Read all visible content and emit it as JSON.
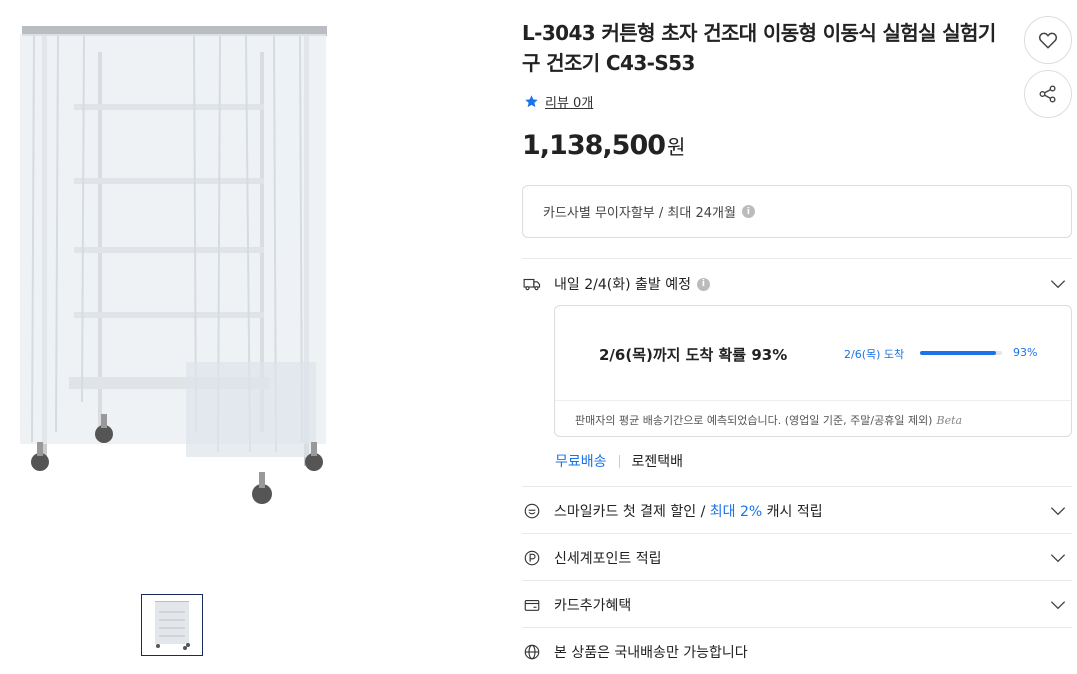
{
  "product": {
    "title": "L-3043 커튼형 초자 건조대 이동형 이동식 실험실 실험기구 건조기 C43-S53",
    "review_label": "리뷰 0개",
    "price_number": "1,138,500",
    "price_unit": "원"
  },
  "installment": {
    "text": "카드사별 무이자할부 / 최대 24개월"
  },
  "delivery": {
    "dispatch_text": "내일 2/4(화) 출발 예정",
    "probability_text": "2/6(목)까지 도착 확률 93%",
    "bar_label": "2/6(목) 도착",
    "bar_percent_label": "93%",
    "bar_value": 0.93,
    "note": "판매자의 평균 배송기간으로 예측되었습니다. (영업일 기준, 주말/공휴일 제외)",
    "beta": "Beta",
    "free_shipping": "무료배송",
    "carrier": "로젠택배"
  },
  "benefits": {
    "smile_card_prefix": "스마일카드 첫 결제 할인 / ",
    "smile_card_highlight": "최대 2%",
    "smile_card_suffix": " 캐시 적립",
    "shinsegae_point": "신세계포인트 적립",
    "card_extra": "카드추가혜택",
    "domestic_only": "본 상품은 국내배송만 가능합니다"
  },
  "colors": {
    "accent": "#1a73e8",
    "text": "#222222",
    "border": "#dddddd"
  },
  "icons": [
    "heart-icon",
    "share-icon",
    "star-icon",
    "info-icon",
    "truck-icon",
    "chevron-down-icon",
    "smile-card-icon",
    "point-icon",
    "card-icon",
    "globe-icon"
  ]
}
